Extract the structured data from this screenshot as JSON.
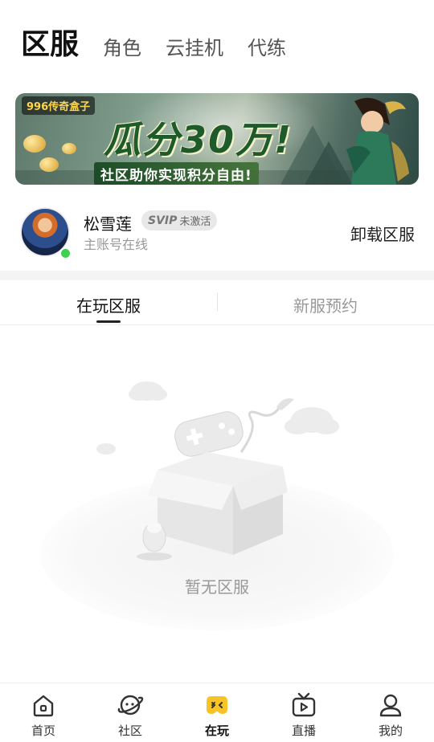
{
  "top_tabs": [
    {
      "label": "区服",
      "active": true
    },
    {
      "label": "角色",
      "active": false
    },
    {
      "label": "云挂机",
      "active": false
    },
    {
      "label": "代练",
      "active": false
    }
  ],
  "banner": {
    "brand": "996传奇盒子",
    "headline": "瓜分30万!",
    "subline": "社区助你实现积分自由!"
  },
  "user": {
    "name": "松雪莲",
    "vip_tier": "SVIP",
    "vip_status": "未激活",
    "account_status": "主账号在线",
    "online": true,
    "action_label": "卸载区服"
  },
  "sub_tabs": [
    {
      "label": "在玩区服",
      "active": true
    },
    {
      "label": "新服预约",
      "active": false
    }
  ],
  "empty_state": {
    "message": "暂无区服"
  },
  "bottom_nav": [
    {
      "label": "首页",
      "icon": "home-icon",
      "active": false
    },
    {
      "label": "社区",
      "icon": "planet-icon",
      "active": false
    },
    {
      "label": "在玩",
      "icon": "gamepad-icon",
      "active": true
    },
    {
      "label": "直播",
      "icon": "tv-icon",
      "active": false
    },
    {
      "label": "我的",
      "icon": "user-icon",
      "active": false
    }
  ],
  "colors": {
    "accent_yellow": "#f7c325",
    "online_green": "#3cd24f",
    "text_primary": "#111111",
    "text_secondary": "#999999"
  }
}
